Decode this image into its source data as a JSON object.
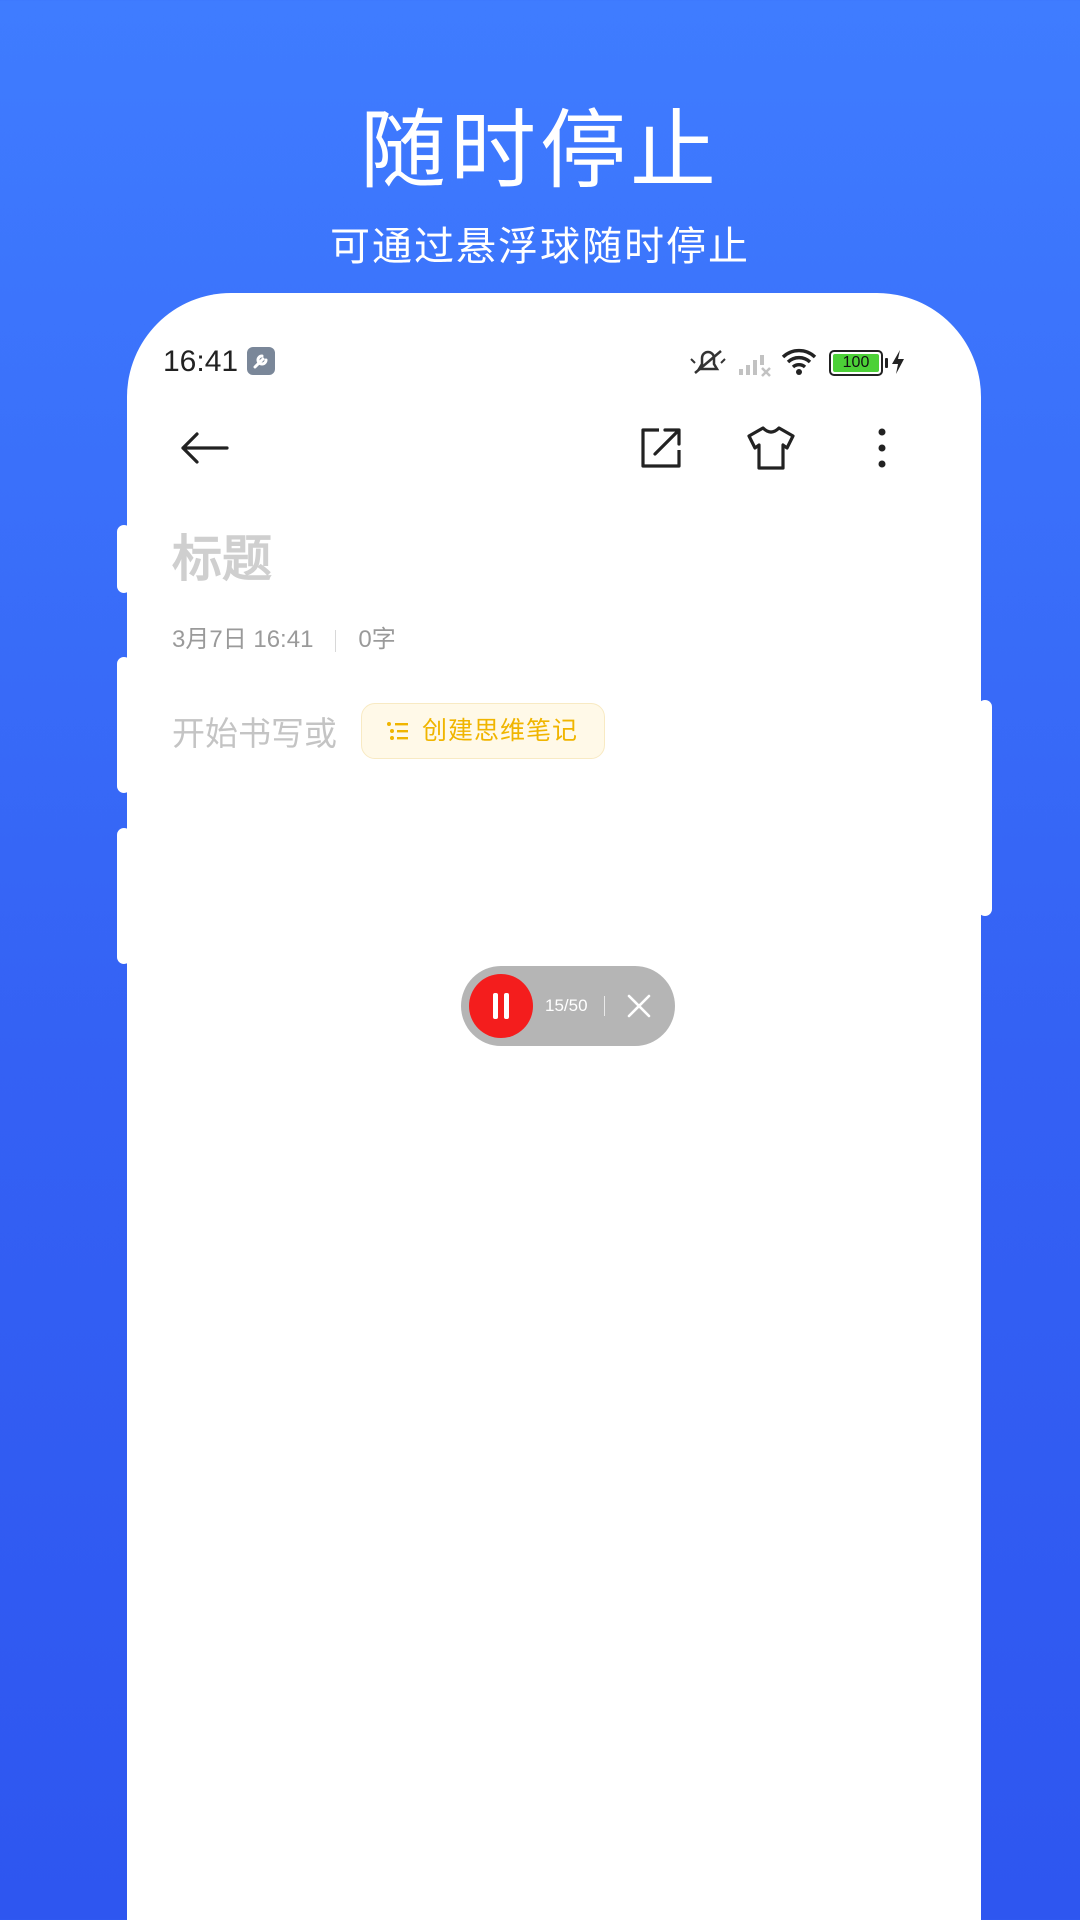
{
  "hero": {
    "title": "随时停止",
    "subtitle": "可通过悬浮球随时停止"
  },
  "status_bar": {
    "time": "16:41",
    "battery": "100",
    "icons": [
      "wrench-icon",
      "mute-icon",
      "signal-off-icon",
      "wifi-icon",
      "battery-icon",
      "charging-icon"
    ]
  },
  "toolbar": {
    "icons": [
      "back-arrow-icon",
      "share-icon",
      "theme-shirt-icon",
      "more-vertical-icon"
    ]
  },
  "note": {
    "title_placeholder": "标题",
    "date": "3月7日 16:41",
    "word_count": "0字",
    "body_placeholder": "开始书写或",
    "mind_note_label": "创建思维笔记"
  },
  "float_ball": {
    "progress_text": "15/50",
    "progress": {
      "current": 15,
      "total": 50
    }
  },
  "colors": {
    "background_top": "#3f7cff",
    "background_bottom": "#2e56f0",
    "record_red": "#f41d1d",
    "mind_chip_text": "#f0b500",
    "battery_green": "#4cd137"
  }
}
